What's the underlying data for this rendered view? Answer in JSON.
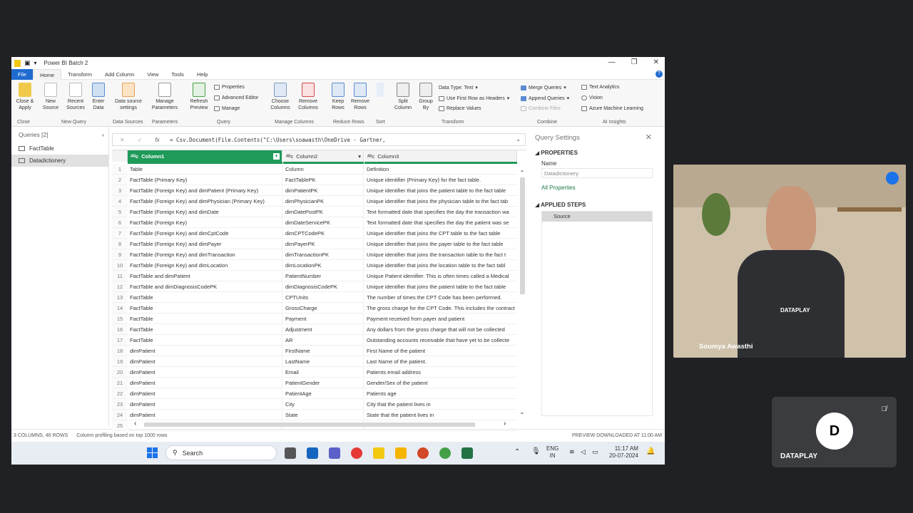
{
  "window": {
    "title": "Power BI Batch 2",
    "minimize": "—",
    "restore": "❐",
    "close": "✕"
  },
  "menu": {
    "file": "File",
    "tabs": [
      "Home",
      "Transform",
      "Add Column",
      "View",
      "Tools",
      "Help"
    ]
  },
  "ribbon": {
    "close_apply": "Close &\nApply",
    "new_source": "New\nSource",
    "recent_sources": "Recent\nSources",
    "enter_data": "Enter\nData",
    "data_source_settings": "Data source\nsettings",
    "manage_parameters": "Manage\nParameters",
    "refresh_preview": "Refresh\nPreview",
    "properties": "Properties",
    "advanced_editor": "Advanced Editor",
    "manage": "Manage",
    "choose_columns": "Choose\nColumns",
    "remove_columns": "Remove\nColumns",
    "keep_rows": "Keep\nRows",
    "remove_rows": "Remove\nRows",
    "split_column": "Split\nColumn",
    "group_by": "Group\nBy",
    "data_type": "Data Type: Text",
    "use_first_row": "Use First Row as Headers",
    "replace_values": "Replace Values",
    "merge_queries": "Merge Queries",
    "append_queries": "Append Queries",
    "combine_files": "Combine Files",
    "text_analytics": "Text Analytics",
    "vision": "Vision",
    "azure_ml": "Azure Machine Learning",
    "groups": [
      "Close",
      "New Query",
      "Data Sources",
      "Parameters",
      "Query",
      "Manage Columns",
      "Reduce Rows",
      "Sort",
      "Transform",
      "Combine",
      "AI Insights"
    ]
  },
  "queries": {
    "header": "Queries [2]",
    "items": [
      "FactTable",
      "Datadictionery"
    ]
  },
  "formula": {
    "text": "= Csv.Document(File.Contents(\"C:\\Users\\soawasth\\OneDrive - Gartner,"
  },
  "grid": {
    "headers": [
      "Column1",
      "Column2",
      "Column3"
    ],
    "rows": [
      [
        "1",
        "Table",
        "Column",
        "Definition"
      ],
      [
        "2",
        "FactTable (Primary Key)",
        "FactTablePK",
        "Unique identifier (Primary Key) for the fact table."
      ],
      [
        "3",
        "FactTable (Foreign Key) and dimPatient (Primary Key)",
        "dimPatientPK",
        "Unique identifier that joins the patient table to the fact table"
      ],
      [
        "4",
        "FactTable (Foreign Key) and dimPhysician (Primary Key)",
        "dimPhysicianPK",
        "Unique identifier that joins the physician table to the fact tab"
      ],
      [
        "5",
        "FactTable (Foreign Key) and dimDate",
        "dimDatePostPK",
        "Text formatted date that specifies the day the transaction wa"
      ],
      [
        "6",
        "FactTable (Foreign Key)",
        "dimDateServicePK",
        "Text formatted date that specifies the day the patient was se"
      ],
      [
        "7",
        "FactTable (Foreign Key) and dimCptCode",
        "dimCPTCodePK",
        "Unique identifier that joins the CPT table to the fact table"
      ],
      [
        "8",
        "FactTable (Foreign Key) and dimPayer",
        "dimPayerPK",
        "Unique identifier that joins the payer table to the fact table"
      ],
      [
        "9",
        "FactTable (Foreign Key) and dimTransaction",
        "dimTransactionPK",
        "Unique identifier that joins the transaction table to the fact t"
      ],
      [
        "10",
        "FactTable (Foreign Key) and dimLocation",
        "dimLocationPK",
        "Unique identifier that joins the location table to the fact tabl"
      ],
      [
        "11",
        "FactTable and dimPatient",
        "PatientNumber",
        "Unique Patient identifier. This is often times called a Medical"
      ],
      [
        "12",
        "FactTable and dimDiagnosisCodePK",
        "dimDiagnosisCodePK",
        "Unique identifier that joins the patient table to the fact table"
      ],
      [
        "13",
        "FactTable",
        "CPTUnits",
        "The number of times the CPT Code has been performed."
      ],
      [
        "14",
        "FactTable",
        "GrossCharge",
        "The gross charge for the CPT Code. This includes the contract"
      ],
      [
        "15",
        "FactTable",
        "Payment",
        "Payment received from payer and patient"
      ],
      [
        "16",
        "FactTable",
        "Adjustment",
        "Any dollars from the gross charge that will not be collected"
      ],
      [
        "17",
        "FactTable",
        "AR",
        "Outstanding accounts receivable that have yet to be collecte"
      ],
      [
        "18",
        "dimPatient",
        "FirstName",
        "First Name of the patient"
      ],
      [
        "19",
        "dimPatient",
        "LastName",
        "Last Name of the patient."
      ],
      [
        "20",
        "dimPatient",
        "Email",
        "Patients email address"
      ],
      [
        "21",
        "dimPatient",
        "PatientGender",
        "Gender/Sex of the patient"
      ],
      [
        "22",
        "dimPatient",
        "PatientAge",
        "Patients age"
      ],
      [
        "23",
        "dimPatient",
        "City",
        "City that the patient lives in"
      ],
      [
        "24",
        "dimPatient",
        "State",
        "State that the patient lives in"
      ],
      [
        "25",
        "",
        "",
        ""
      ]
    ]
  },
  "settings": {
    "title": "Query Settings",
    "properties": "PROPERTIES",
    "name_label": "Name",
    "name_value": "Datadictionery",
    "all_properties": "All Properties",
    "applied_steps": "APPLIED STEPS",
    "steps": [
      "Source"
    ]
  },
  "status": {
    "left": "3 COLUMNS, 46 ROWS",
    "profiling": "Column profiling based on top 1000 rows",
    "right": "PREVIEW DOWNLOADED AT 11:00 AM"
  },
  "taskbar": {
    "search": "Search",
    "lang1": "ENG",
    "lang2": "IN",
    "time": "11:17 AM",
    "date": "20-07-2024"
  },
  "video": {
    "presenter": "Soumya Awasthi",
    "shirt_text": "DATAPLAY",
    "tile_label": "DATAPLAY",
    "logo": "D"
  },
  "colors": {
    "accent": "#1f6bd0",
    "column_header": "#1e9a59",
    "ai_green": "#1e9a59"
  }
}
